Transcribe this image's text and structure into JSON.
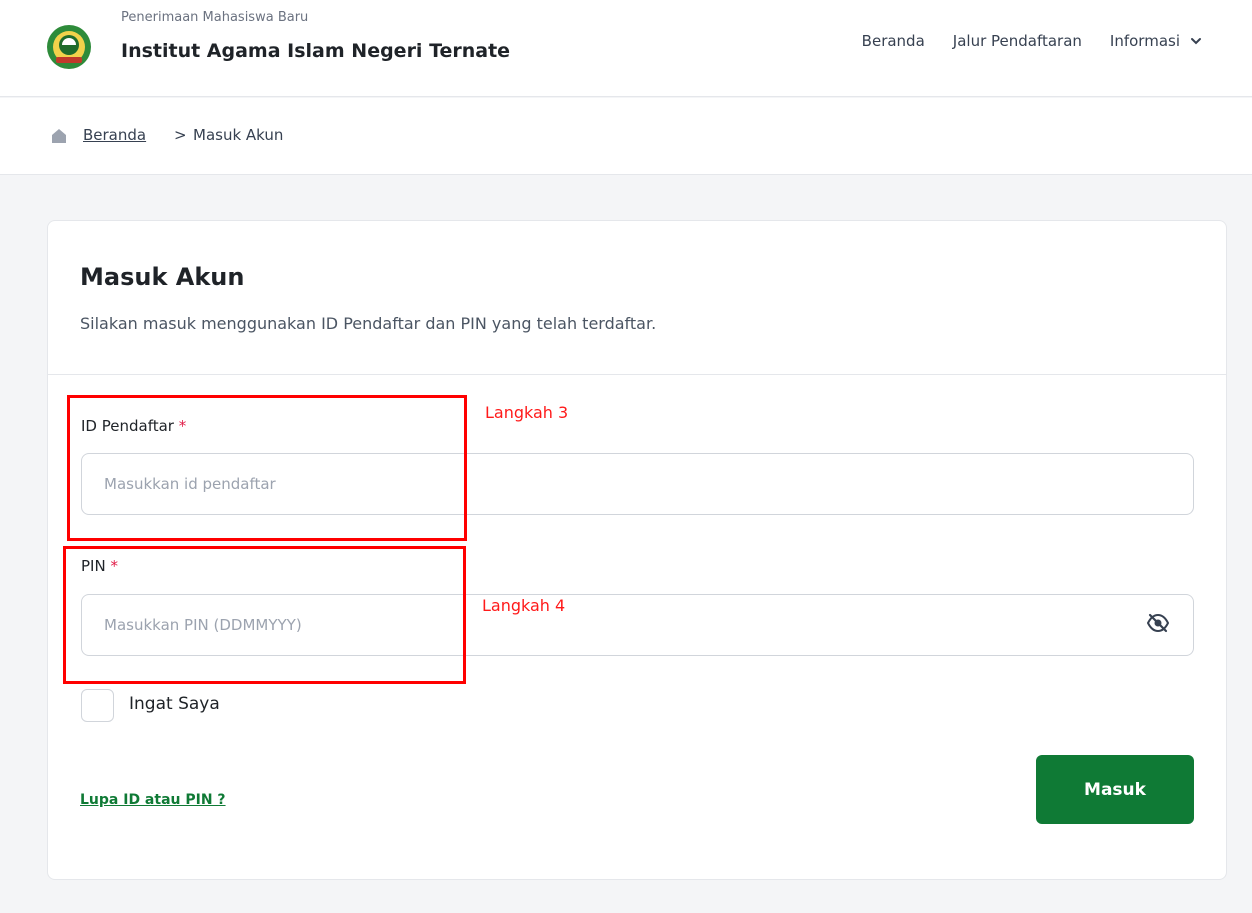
{
  "header": {
    "subtitle": "Penerimaan Mahasiswa Baru",
    "title": "Institut Agama Islam Negeri Ternate",
    "logo_icon": "university-seal-icon",
    "nav": [
      {
        "label": "Beranda"
      },
      {
        "label": "Jalur Pendaftaran"
      },
      {
        "label": "Informasi",
        "icon": "chevron-down-icon"
      }
    ]
  },
  "breadcrumb": {
    "home_icon": "home-icon",
    "link": "Beranda",
    "separator": ">",
    "current": "Masuk Akun"
  },
  "form": {
    "title": "Masuk Akun",
    "description": "Silakan masuk menggunakan ID Pendaftar dan PIN yang telah terdaftar.",
    "id_field": {
      "label": "ID Pendaftar",
      "required_mark": "*",
      "placeholder": "Masukkan id pendaftar",
      "value": ""
    },
    "pin_field": {
      "label": "PIN",
      "required_mark": "*",
      "placeholder": "Masukkan PIN (DDMMYYY)",
      "value": "",
      "toggle_icon": "eye-off-icon"
    },
    "remember_label": "Ingat Saya",
    "remember_checked": false,
    "forgot_link": "Lupa ID atau PIN ?",
    "submit_label": "Masuk"
  },
  "annotations": {
    "step3": "Langkah 3",
    "step4": "Langkah 4",
    "color": "#ff0000"
  },
  "colors": {
    "brand_green": "#0f7a35",
    "required_red": "#e11d48"
  }
}
